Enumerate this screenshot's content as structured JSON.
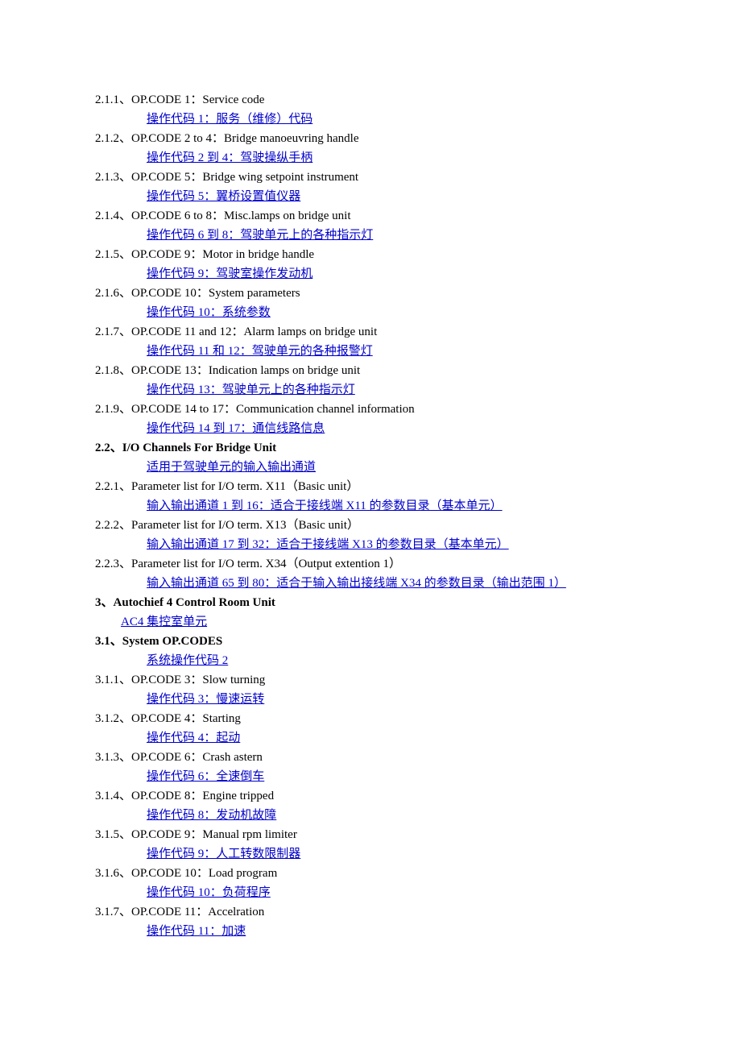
{
  "entries": [
    {
      "num": "2.1.1",
      "title": "OP.CODE 1：Service code",
      "link": "操作代码 1：服务（维修）代码",
      "bold": false,
      "indent": 64
    },
    {
      "num": "2.1.2",
      "title": "OP.CODE 2 to 4：Bridge manoeuvring handle",
      "link": "操作代码 2 到 4：驾驶操纵手柄",
      "bold": false,
      "indent": 64
    },
    {
      "num": "2.1.3",
      "title": "OP.CODE 5：Bridge wing setpoint instrument",
      "link": "操作代码 5：翼桥设置值仪器",
      "bold": false,
      "indent": 64
    },
    {
      "num": "2.1.4",
      "title": "OP.CODE 6 to 8：Misc.lamps on bridge unit",
      "link": "操作代码 6 到 8：驾驶单元上的各种指示灯",
      "bold": false,
      "indent": 64
    },
    {
      "num": "2.1.5",
      "title": "OP.CODE 9：Motor in bridge handle",
      "link": "操作代码 9：驾驶室操作发动机",
      "bold": false,
      "indent": 64
    },
    {
      "num": "2.1.6",
      "title": "OP.CODE 10：System parameters",
      "link": "操作代码 10：系统参数",
      "bold": false,
      "indent": 64
    },
    {
      "num": "2.1.7",
      "title": "OP.CODE 11 and 12：Alarm lamps on bridge unit",
      "link": "操作代码 11 和 12：驾驶单元的各种报警灯",
      "bold": false,
      "indent": 64
    },
    {
      "num": "2.1.8",
      "title": "OP.CODE 13：Indication lamps on bridge unit",
      "link": "操作代码 13：驾驶单元上的各种指示灯",
      "bold": false,
      "indent": 64
    },
    {
      "num": "2.1.9",
      "title": "OP.CODE 14 to 17：Communication channel information",
      "link": "操作代码 14 到 17：通信线路信息",
      "bold": false,
      "indent": 64
    },
    {
      "num": "2.2",
      "title": "I/O Channels For Bridge Unit",
      "link": "适用于驾驶单元的输入输出通道",
      "bold": true,
      "indent": 64
    },
    {
      "num": "2.2.1",
      "title": "Parameter list for I/O term.  X11（Basic unit）",
      "link": "输入输出通道 1 到 16：适合于接线端 X11 的参数目录（基本单元）",
      "bold": false,
      "indent": 64
    },
    {
      "num": "2.2.2",
      "title": "Parameter list for I/O term.  X13（Basic unit）",
      "link": "输入输出通道 17 到 32：适合于接线端 X13 的参数目录（基本单元）",
      "bold": false,
      "indent": 64
    },
    {
      "num": "2.2.3",
      "title": "Parameter list for I/O term.  X34（Output extention 1）",
      "link": "输入输出通道 65 到 80：适合于输入输出接线端 X34 的参数目录（输出范围 1）",
      "bold": false,
      "indent": 64
    },
    {
      "num": "3",
      "title": "Autochief 4 Control Room Unit",
      "link": "AC4 集控室单元",
      "bold": true,
      "indent": 32
    },
    {
      "num": "3.1",
      "title": "System OP.CODES",
      "link": "系统操作代码 2",
      "bold": true,
      "indent": 64
    },
    {
      "num": "3.1.1",
      "title": "OP.CODE 3：Slow turning",
      "link": "操作代码 3：慢速运转",
      "bold": false,
      "indent": 64
    },
    {
      "num": "3.1.2",
      "title": "OP.CODE 4：Starting",
      "link": "操作代码 4：起动",
      "bold": false,
      "indent": 64
    },
    {
      "num": "3.1.3",
      "title": "OP.CODE 6：Crash astern",
      "link": "操作代码 6：全速倒车",
      "bold": false,
      "indent": 64
    },
    {
      "num": "3.1.4",
      "title": "OP.CODE 8：Engine tripped",
      "link": "操作代码 8：发动机故障",
      "bold": false,
      "indent": 64
    },
    {
      "num": "3.1.5",
      "title": "OP.CODE 9：Manual rpm limiter",
      "link": "操作代码 9：人工转数限制器",
      "bold": false,
      "indent": 64
    },
    {
      "num": "3.1.6",
      "title": "OP.CODE 10：Load program",
      "link": "操作代码 10：负荷程序",
      "bold": false,
      "indent": 64
    },
    {
      "num": "3.1.7",
      "title": "OP.CODE 11：Accelration",
      "link": "操作代码 11：加速",
      "bold": false,
      "indent": 64
    }
  ],
  "separator": "、"
}
